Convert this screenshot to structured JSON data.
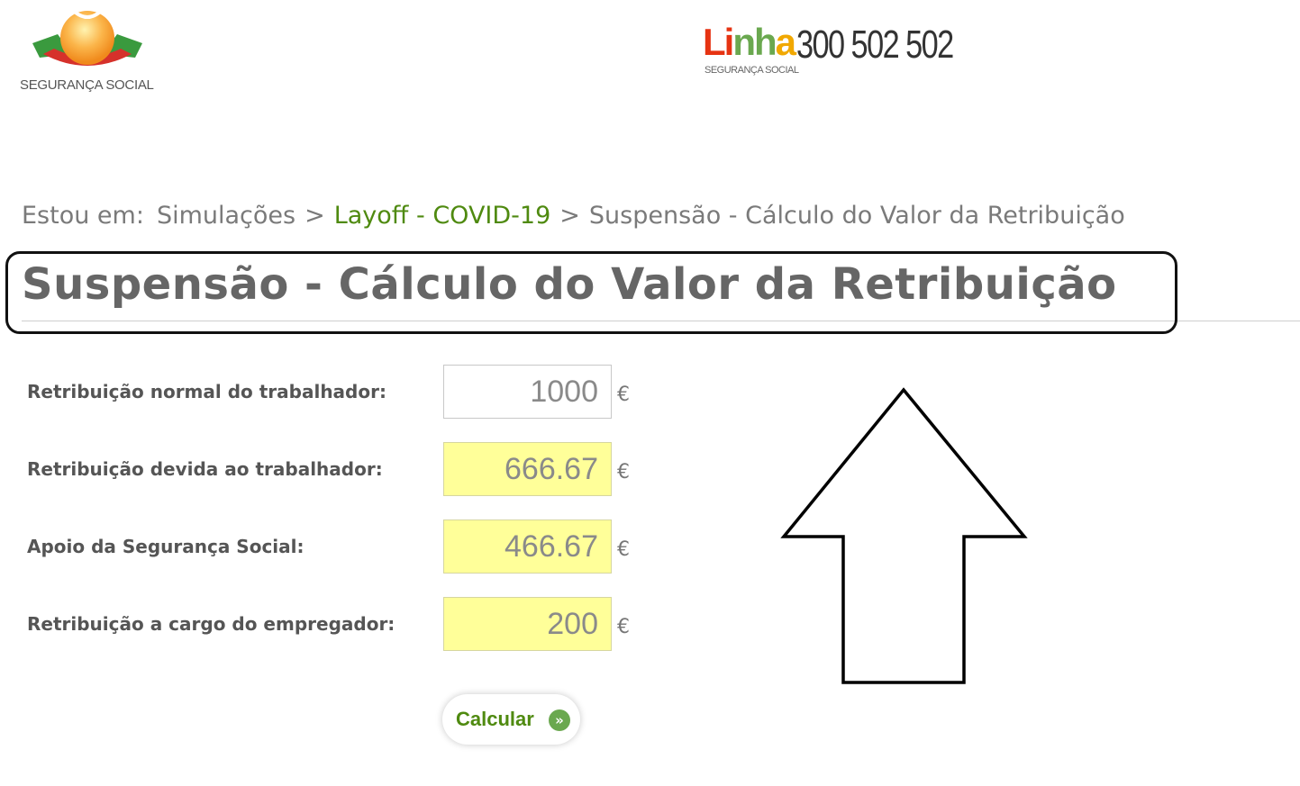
{
  "header": {
    "logo_text": "SEGURANÇA SOCIAL",
    "linha_word": [
      "Li",
      "nh",
      "a"
    ],
    "linha_sub": "SEGURANÇA SOCIAL",
    "phone": "300 502 502"
  },
  "breadcrumb": {
    "prefix": "Estou em:",
    "items": [
      "Simulações",
      "Layoff - COVID-19",
      "Suspensão - Cálculo do Valor da Retribuição"
    ],
    "separator": ">"
  },
  "page": {
    "title": "Suspensão - Cálculo do Valor da Retribuição"
  },
  "form": {
    "rows": [
      {
        "label": "Retribuição normal do trabalhador:",
        "value": "1000",
        "currency": "€"
      },
      {
        "label": "Retribuição devida ao trabalhador:",
        "value": "666.67",
        "currency": "€"
      },
      {
        "label": "Apoio da Segurança Social:",
        "value": "466.67",
        "currency": "€"
      },
      {
        "label": "Retribuição a cargo do empregador:",
        "value": "200",
        "currency": "€"
      }
    ],
    "calculate_label": "Calcular",
    "calculate_icon": "»"
  },
  "colors": {
    "accent_green": "#4f8a10",
    "result_yellow": "#ffff99",
    "text_grey": "#666666"
  },
  "icons": {
    "logo": "seguranca-social-logo",
    "arrow": "up-arrow-annotation"
  }
}
